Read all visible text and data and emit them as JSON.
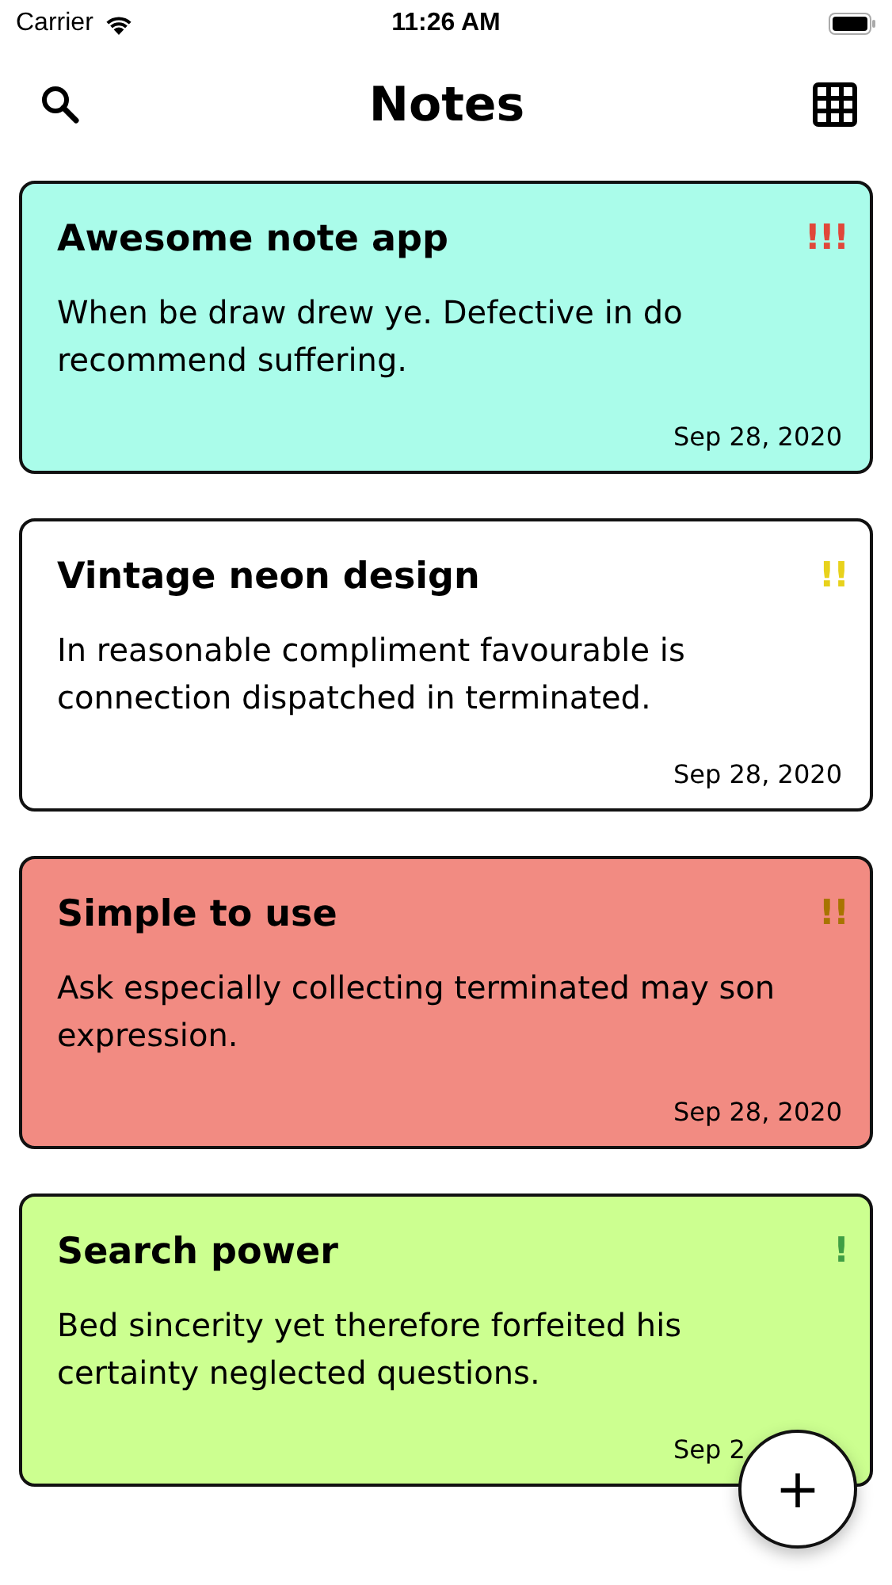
{
  "status_bar": {
    "carrier": "Carrier",
    "time": "11:26 AM"
  },
  "header": {
    "title": "Notes"
  },
  "notes": [
    {
      "title": "Awesome note app",
      "priority": {
        "mark": "!!!",
        "color": "#e0483a"
      },
      "body": "When be draw drew ye. Defective in do recommend suffering.",
      "date": "Sep 28, 2020",
      "color": "#aafcea"
    },
    {
      "title": "Vintage neon design",
      "priority": {
        "mark": "!!",
        "color": "#e8d21c"
      },
      "body": "In reasonable compliment favourable is connection dispatched in terminated.",
      "date": "Sep 28, 2020",
      "color": "#ffffff"
    },
    {
      "title": "Simple to use",
      "priority": {
        "mark": "!!",
        "color": "#a87400"
      },
      "body": "Ask especially collecting terminated may son expression.",
      "date": "Sep 28, 2020",
      "color": "#f28b82"
    },
    {
      "title": "Search power",
      "priority": {
        "mark": "!",
        "color": "#3f9f44"
      },
      "body": "Bed sincerity yet therefore forfeited his certainty neglected questions.",
      "date": "Sep 2",
      "color": "#ccff90"
    }
  ],
  "add_button": {
    "label": "+"
  }
}
